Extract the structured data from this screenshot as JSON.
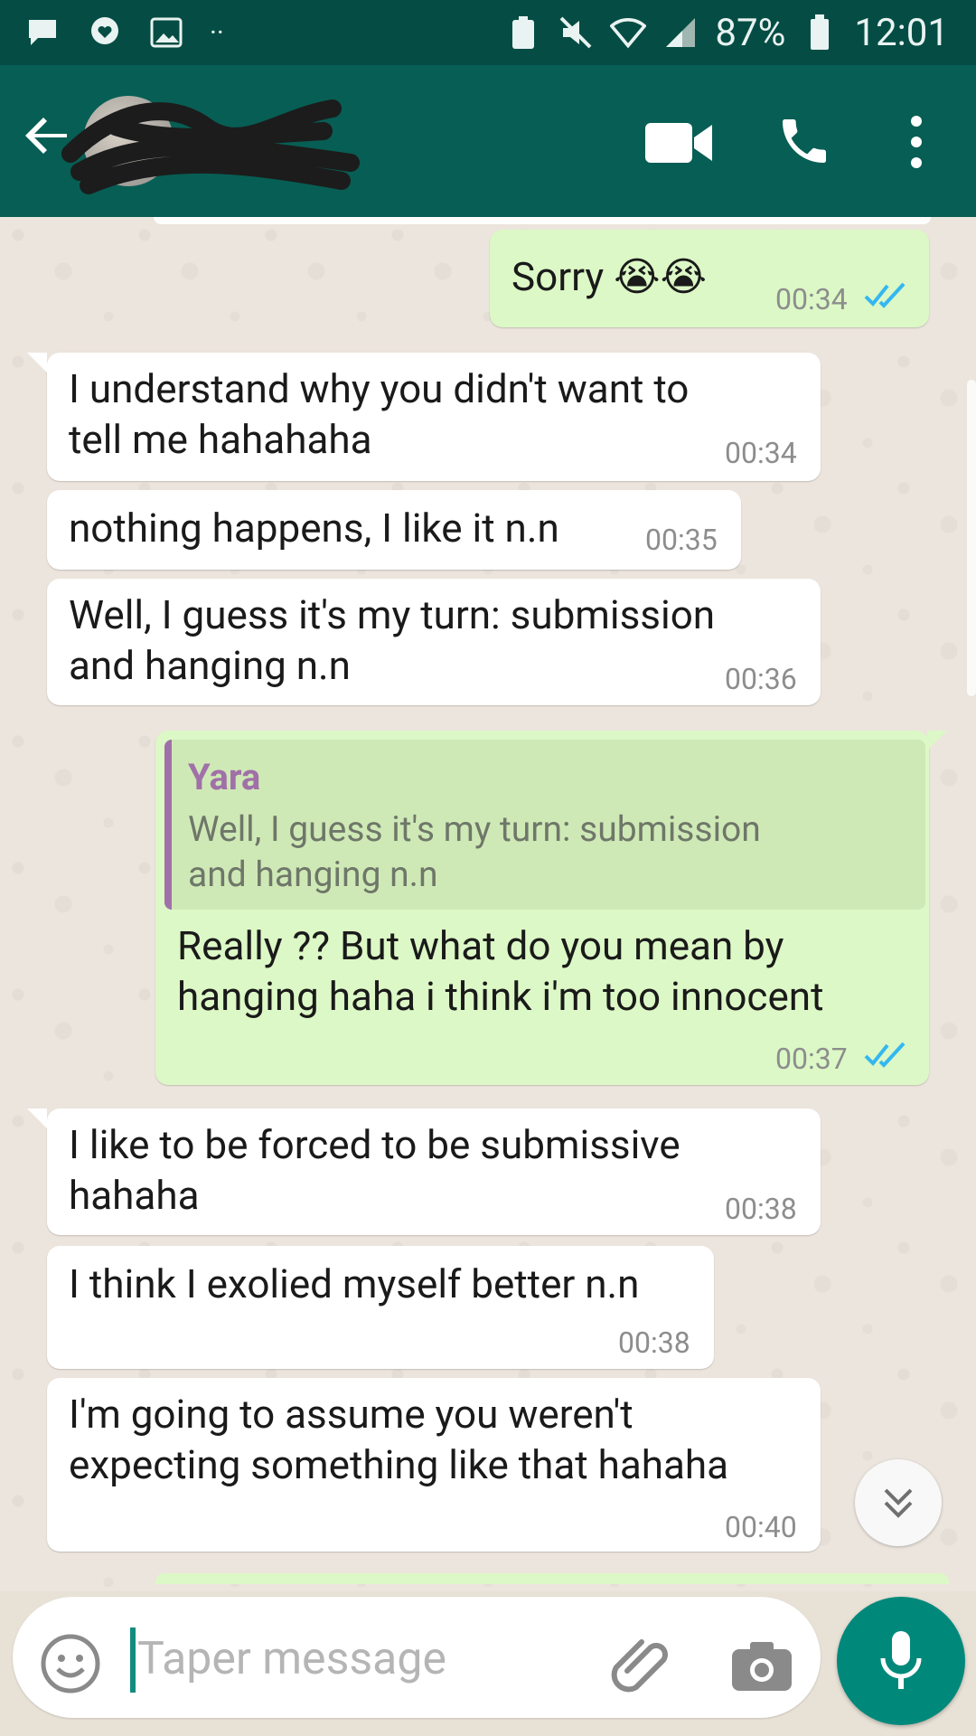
{
  "status_bar": {
    "battery": "87%",
    "time": "12:01"
  },
  "header": {
    "contact_name": "",
    "icons": [
      "back-arrow-icon",
      "video-call-icon",
      "phone-icon",
      "more-vert-icon"
    ]
  },
  "messages": [
    {
      "dir": "out",
      "text": "Sorry 😭😭",
      "time": "00:34",
      "status": "read"
    },
    {
      "dir": "in",
      "text_lines": [
        "I understand why you didn't want to",
        "tell me hahahaha"
      ],
      "time": "00:34"
    },
    {
      "dir": "in",
      "text": "nothing happens, I like it n.n",
      "time": "00:35"
    },
    {
      "dir": "in",
      "text_lines": [
        "Well, I guess it's my turn: submission",
        "and hanging n.n"
      ],
      "time": "00:36"
    },
    {
      "dir": "out",
      "quote": {
        "author": "Yara",
        "text_lines": [
          "Well, I guess it's my turn: submission",
          "and hanging n.n"
        ]
      },
      "text_lines": [
        "Really ?? But what do you mean by",
        "hanging haha i think i'm too innocent"
      ],
      "time": "00:37",
      "status": "read"
    },
    {
      "dir": "in",
      "text_lines": [
        "I like to be forced to be submissive",
        "hahaha"
      ],
      "time": "00:38"
    },
    {
      "dir": "in",
      "text": "I think I exolied myself better n.n",
      "time": "00:38"
    },
    {
      "dir": "in",
      "text_lines": [
        "I'm going to assume you weren't",
        "expecting something like that hahaha"
      ],
      "time": "00:40"
    }
  ],
  "composer": {
    "placeholder": "Taper message"
  },
  "colors": {
    "header": "#075e54",
    "status_bar": "#054d44",
    "outgoing_bubble": "#dcf8c6",
    "incoming_bubble": "#ffffff",
    "read_ticks": "#34b7f1",
    "mic_button": "#00897b",
    "quote_author": "#a070a8"
  }
}
